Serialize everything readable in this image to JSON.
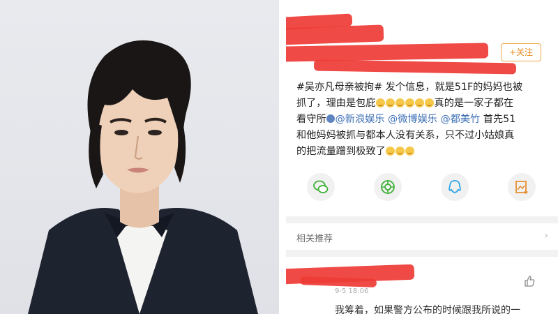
{
  "post": {
    "follow_label": "+关注",
    "text_segments": {
      "line1": "#吴亦凡母亲被拘# 发个信息，就是51F的妈妈也被",
      "line2_start": "抓了，理由是包庇",
      "line2_end": "真的是一家子都在",
      "line3_start": "看守所",
      "mention1": "@新浪娱乐",
      "mention2": "@微博娱乐",
      "mention3": "@都美竹",
      "line3_end": " 首先51",
      "line4": "和他妈妈被抓与都本人没有关系，只不过小姑娘真",
      "line5": "的把流量蹭到极致了"
    }
  },
  "share": {
    "items": [
      "wechat-icon",
      "moments-icon",
      "qq-icon",
      "save-image-icon"
    ]
  },
  "related": {
    "label": "相关推荐",
    "chevron": "›"
  },
  "comment": {
    "time": "9-5 18:06",
    "text": "我筹着，如果警方公布的时候跟我所说的一"
  },
  "colors": {
    "redaction": "#ee3b35",
    "mention": "#3d6fb6",
    "follow": "#e8891f"
  }
}
